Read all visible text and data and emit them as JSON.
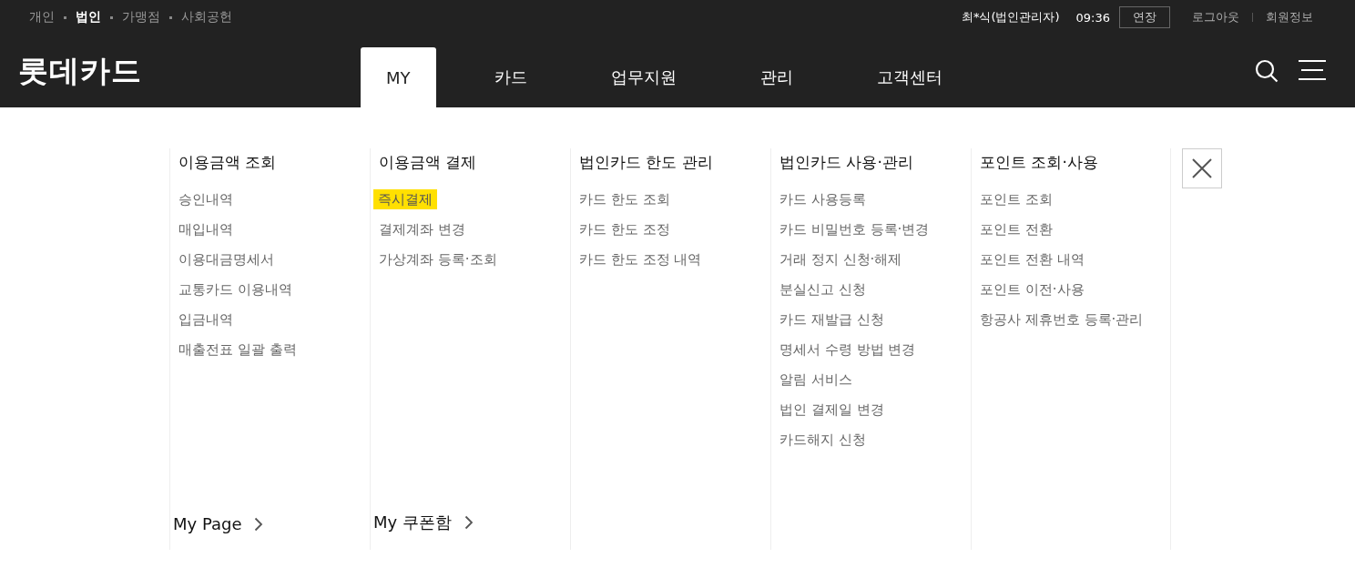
{
  "sites": [
    {
      "label": "개인",
      "selected": false
    },
    {
      "label": "법인",
      "selected": true
    },
    {
      "label": "가맹점",
      "selected": false
    },
    {
      "label": "사회공헌",
      "selected": false
    }
  ],
  "user": {
    "name": "최*식(법인관리자)",
    "timer": "09:36",
    "extend_button": "연장",
    "links": [
      "로그아웃",
      "회원정보"
    ]
  },
  "logo": "롯데카드",
  "nav_tabs": [
    {
      "label": "MY",
      "selected": true
    },
    {
      "label": "카드",
      "selected": false
    },
    {
      "label": "업무지원",
      "selected": false
    },
    {
      "label": "관리",
      "selected": false
    },
    {
      "label": "고객센터",
      "selected": false
    }
  ],
  "menu_columns": [
    {
      "title": "이용금액 조회",
      "items": [
        {
          "label": "승인내역",
          "selected": false
        },
        {
          "label": "매입내역",
          "selected": false
        },
        {
          "label": "이용대금명세서",
          "selected": false
        },
        {
          "label": "교통카드 이용내역",
          "selected": false
        },
        {
          "label": "입금내역",
          "selected": false
        },
        {
          "label": "매출전표 일괄 출력",
          "selected": false
        }
      ],
      "footer_link": "My Page"
    },
    {
      "title": "이용금액 결제",
      "items": [
        {
          "label": "즉시결제",
          "selected": true
        },
        {
          "label": "결제계좌 변경",
          "selected": false
        },
        {
          "label": "가상계좌 등록·조회",
          "selected": false
        }
      ],
      "footer_link": "My 쿠폰함"
    },
    {
      "title": "법인카드 한도 관리",
      "items": [
        {
          "label": "카드 한도 조회",
          "selected": false
        },
        {
          "label": "카드 한도 조정",
          "selected": false
        },
        {
          "label": "카드 한도 조정 내역",
          "selected": false
        }
      ]
    },
    {
      "title": "법인카드 사용·관리",
      "items": [
        {
          "label": "카드 사용등록",
          "selected": false
        },
        {
          "label": "카드 비밀번호 등록·변경",
          "selected": false
        },
        {
          "label": "거래 정지 신청·해제",
          "selected": false
        },
        {
          "label": "분실신고 신청",
          "selected": false
        },
        {
          "label": "카드 재발급 신청",
          "selected": false
        },
        {
          "label": "명세서 수령 방법 변경",
          "selected": false
        },
        {
          "label": "알림 서비스",
          "selected": false
        },
        {
          "label": "법인 결제일 변경",
          "selected": false
        },
        {
          "label": "카드해지 신청",
          "selected": false
        }
      ]
    },
    {
      "title": "포인트 조회·사용",
      "items": [
        {
          "label": "포인트 조회",
          "selected": false
        },
        {
          "label": "포인트 전환",
          "selected": false
        },
        {
          "label": "포인트 전환 내역",
          "selected": false
        },
        {
          "label": "포인트 이전·사용",
          "selected": false
        },
        {
          "label": "항공사 제휴번호 등록·관리",
          "selected": false
        }
      ]
    }
  ]
}
